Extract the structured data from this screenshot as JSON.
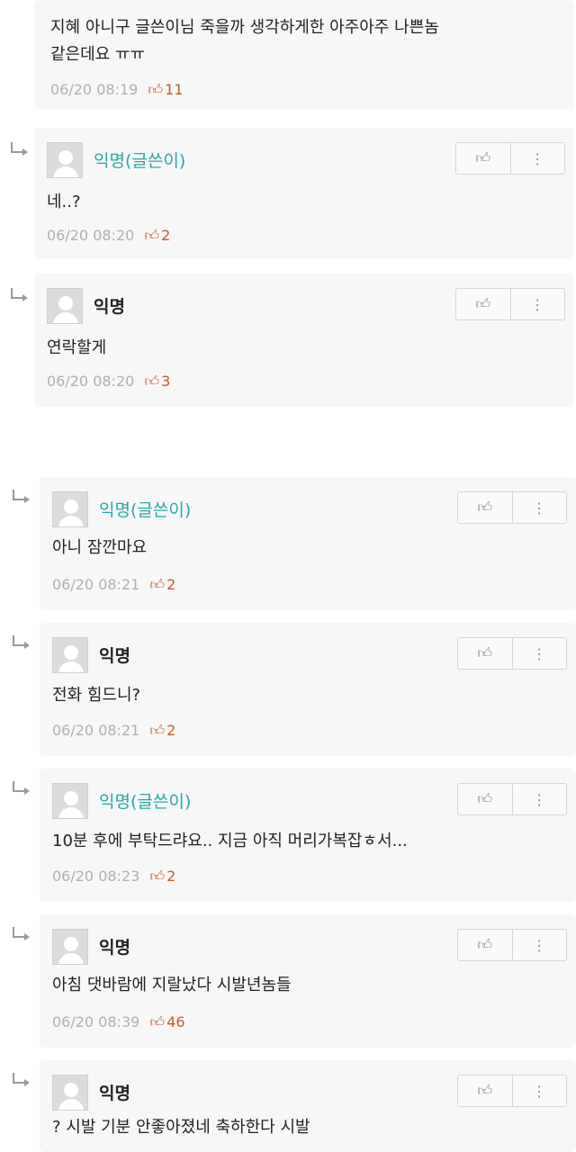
{
  "comments": [
    {
      "is_reply": false,
      "author": "",
      "text_lines": [
        "지혜 아니구 글쓴이님 죽을까 생각하게한 아주아주 나쁜놈",
        "같은데요 ㅠㅠ"
      ],
      "time": "06/20 08:19",
      "likes": "11"
    },
    {
      "is_reply": true,
      "author": "익명(글쓴이)",
      "author_is_op": true,
      "text_lines": [
        "네..?"
      ],
      "time": "06/20 08:20",
      "likes": "2"
    },
    {
      "is_reply": true,
      "author": "익명",
      "author_is_op": false,
      "text_lines": [
        "연락할게"
      ],
      "time": "06/20 08:20",
      "likes": "3"
    },
    {
      "is_reply": true,
      "author": "익명(글쓴이)",
      "author_is_op": true,
      "text_lines": [
        "아니 잠깐마요"
      ],
      "time": "06/20 08:21",
      "likes": "2"
    },
    {
      "is_reply": true,
      "author": "익명",
      "author_is_op": false,
      "text_lines": [
        "전화 힘드니?"
      ],
      "time": "06/20 08:21",
      "likes": "2"
    },
    {
      "is_reply": true,
      "author": "익명(글쓴이)",
      "author_is_op": true,
      "text_lines": [
        "10분 후에 부탁드랴요.. 지금 아직 머리가복잡ㅎ서..."
      ],
      "time": "06/20 08:23",
      "likes": "2"
    },
    {
      "is_reply": true,
      "author": "익명",
      "author_is_op": false,
      "text_lines": [
        "아침 댓바람에 지랄났다 시발년놈들"
      ],
      "time": "06/20 08:39",
      "likes": "46"
    },
    {
      "is_reply": true,
      "author": "익명",
      "author_is_op": false,
      "text_lines": [
        "? 시발 기분 안좋아졌네 축하한다 시발"
      ],
      "time": "",
      "likes": ""
    }
  ],
  "icons": {
    "thumb": "👍",
    "like_action": "thumbs-up-icon",
    "more_action": "more-vertical-icon",
    "avatar": "default-avatar-icon"
  },
  "colors": {
    "op_author": "#2aa7a7",
    "like": "#c45a2c",
    "meta": "#b0b0b0",
    "card_bg": "#f7f7f7"
  }
}
